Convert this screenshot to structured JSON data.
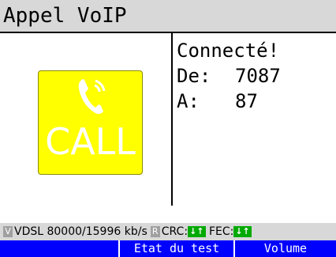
{
  "window": {
    "title": "Appel VoIP"
  },
  "call_button": {
    "label": "CALL",
    "icon": "phone-handset-icon",
    "color": "#ffff00"
  },
  "call_info": {
    "status": "Connecté!",
    "from_label": "De:",
    "from_value": "7087",
    "to_label": "A:",
    "to_value": "87"
  },
  "status_bar": {
    "v_indicator": "V",
    "line": "VDSL 80000/15996 kb/s",
    "r_indicator": "R",
    "crc_label": "CRC:",
    "crc_state": "↓↑",
    "fec_label": "FEC:",
    "fec_state": "↓↑"
  },
  "softkeys": {
    "key1": "",
    "key2": "Etat du test",
    "key3": "Volume"
  }
}
